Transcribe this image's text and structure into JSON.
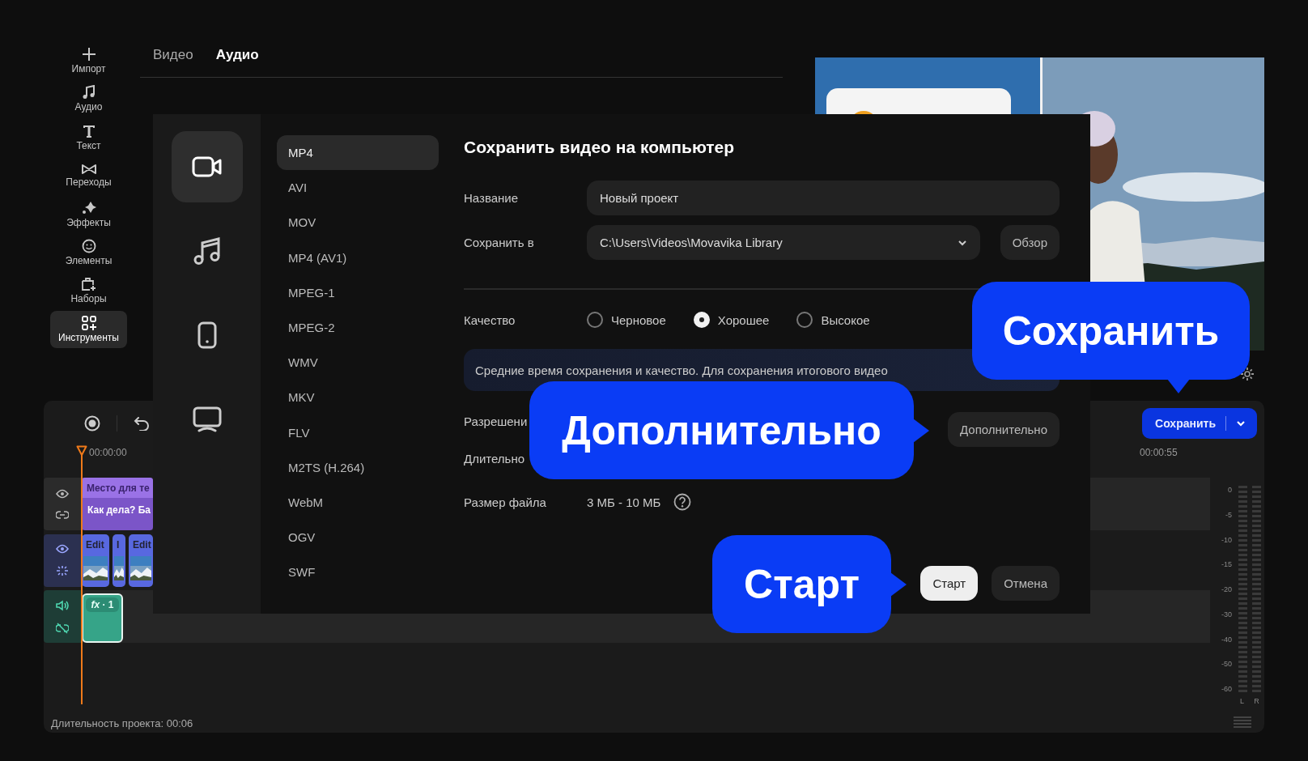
{
  "sidebar": {
    "items": [
      {
        "label": "Импорт",
        "selected": false
      },
      {
        "label": "Аудио",
        "selected": false
      },
      {
        "label": "Текст",
        "selected": false
      },
      {
        "label": "Переходы",
        "selected": false
      },
      {
        "label": "Эффекты",
        "selected": false
      },
      {
        "label": "Элементы",
        "selected": false
      },
      {
        "label": "Наборы",
        "selected": false
      },
      {
        "label": "Инструменты",
        "selected": true
      }
    ]
  },
  "panel": {
    "tabs": [
      {
        "label": "Видео",
        "selected": false
      },
      {
        "label": "Аудио",
        "selected": true
      }
    ]
  },
  "timeline": {
    "start_time": "00:00:00",
    "end_time": "00:00:55",
    "tracks": [
      {
        "kind": "text",
        "clips": [
          {
            "title": "Место для те",
            "subtitle": "Как дела? Ба"
          }
        ]
      },
      {
        "kind": "video",
        "clips": [
          {
            "title": "Edit"
          },
          {
            "title": "I"
          },
          {
            "title": "Edit"
          }
        ]
      },
      {
        "kind": "audio",
        "clips": [
          {
            "title": "*fx* · 1"
          }
        ]
      }
    ],
    "meter_scale": [
      "0",
      "-5",
      "-10",
      "-15",
      "-20",
      "-30",
      "-40",
      "-50",
      "-60"
    ],
    "meter_channels": [
      "L",
      "R"
    ],
    "status": "Длительность проекта: 00:06"
  },
  "save_button": {
    "label": "Сохранить"
  },
  "dialog": {
    "title": "Сохранить видео на компьютер",
    "categories": [
      {
        "selected": true
      },
      {
        "selected": false
      },
      {
        "selected": false
      },
      {
        "selected": false
      }
    ],
    "formats": [
      {
        "label": "MP4",
        "selected": true
      },
      {
        "label": "AVI",
        "selected": false
      },
      {
        "label": "MOV",
        "selected": false
      },
      {
        "label": "MP4 (AV1)",
        "selected": false
      },
      {
        "label": "MPEG-1",
        "selected": false
      },
      {
        "label": "MPEG-2",
        "selected": false
      },
      {
        "label": "WMV",
        "selected": false
      },
      {
        "label": "MKV",
        "selected": false
      },
      {
        "label": "FLV",
        "selected": false
      },
      {
        "label": "M2TS (H.264)",
        "selected": false
      },
      {
        "label": "WebM",
        "selected": false
      },
      {
        "label": "OGV",
        "selected": false
      },
      {
        "label": "SWF",
        "selected": false
      }
    ],
    "name_label": "Название",
    "name_value": "Новый проект",
    "folder_label": "Сохранить в",
    "folder_value": "C:\\Users\\Videos\\Movavika Library",
    "browse_button": "Обзор",
    "quality_label": "Качество",
    "quality_options": [
      {
        "label": "Черновое",
        "selected": false
      },
      {
        "label": "Хорошее",
        "selected": true
      },
      {
        "label": "Высокое",
        "selected": false
      }
    ],
    "quality_hint": "Средние время сохранения и качество. Для сохранения итогового видео",
    "resolution_label": "Разрешени",
    "duration_label": "Длительно",
    "advanced_button": "Дополнительно",
    "size_label": "Размер файла",
    "size_value": "3 МБ - 10 МБ",
    "start_button": "Старт",
    "cancel_button": "Отмена"
  },
  "callouts": [
    {
      "text": "Сохранить"
    },
    {
      "text": "Дополнительно"
    },
    {
      "text": "Старт"
    }
  ]
}
